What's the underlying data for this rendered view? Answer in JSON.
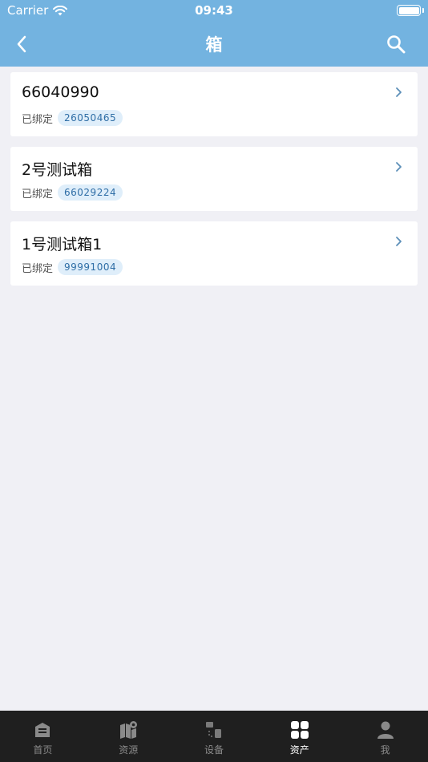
{
  "status_bar": {
    "carrier": "Carrier",
    "time": "09:43"
  },
  "nav": {
    "title": "箱"
  },
  "items": [
    {
      "title": "66040990",
      "status": "已绑定",
      "badge": "26050465"
    },
    {
      "title": "2号测试箱",
      "status": "已绑定",
      "badge": "66029224"
    },
    {
      "title": "1号测试箱1",
      "status": "已绑定",
      "badge": "99991004"
    }
  ],
  "tabs": [
    {
      "label": "首页",
      "icon": "home-icon",
      "active": false
    },
    {
      "label": "资源",
      "icon": "map-pin-icon",
      "active": false
    },
    {
      "label": "设备",
      "icon": "device-icon",
      "active": false
    },
    {
      "label": "资产",
      "icon": "grid-icon",
      "active": true
    },
    {
      "label": "我",
      "icon": "user-icon",
      "active": false
    }
  ],
  "colors": {
    "header": "#73b3e0",
    "badge_bg": "#dfeefa",
    "badge_text": "#2f6ea6",
    "tabbar": "#1f1f1f"
  }
}
